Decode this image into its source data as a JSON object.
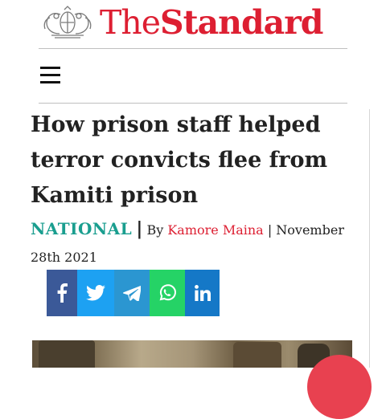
{
  "masthead": {
    "brand_the": "The",
    "brand_name": "Standard",
    "crest_icon": "coat-of-arms-crest"
  },
  "nav": {
    "menu_icon": "hamburger-menu-icon"
  },
  "article": {
    "headline": "How prison staff helped terror convicts flee from Kamiti prison",
    "category": "NATIONAL",
    "separator": "|",
    "by_label": "By",
    "author": "Kamore Maina",
    "date_prefix": "| November",
    "date_rest": "28th 2021"
  },
  "share": {
    "buttons": [
      {
        "name": "facebook",
        "icon": "facebook-icon",
        "color": "#3b5998"
      },
      {
        "name": "twitter",
        "icon": "twitter-icon",
        "color": "#1da1f2"
      },
      {
        "name": "telegram",
        "icon": "telegram-icon",
        "color": "#2b96d1"
      },
      {
        "name": "whatsapp",
        "icon": "whatsapp-icon",
        "color": "#25d366"
      },
      {
        "name": "linkedin",
        "icon": "linkedin-icon",
        "color": "#1578c7"
      }
    ]
  },
  "colors": {
    "brand_red": "#dd1f32",
    "category_teal": "#1a9e8f",
    "fab_red": "#e84150"
  }
}
